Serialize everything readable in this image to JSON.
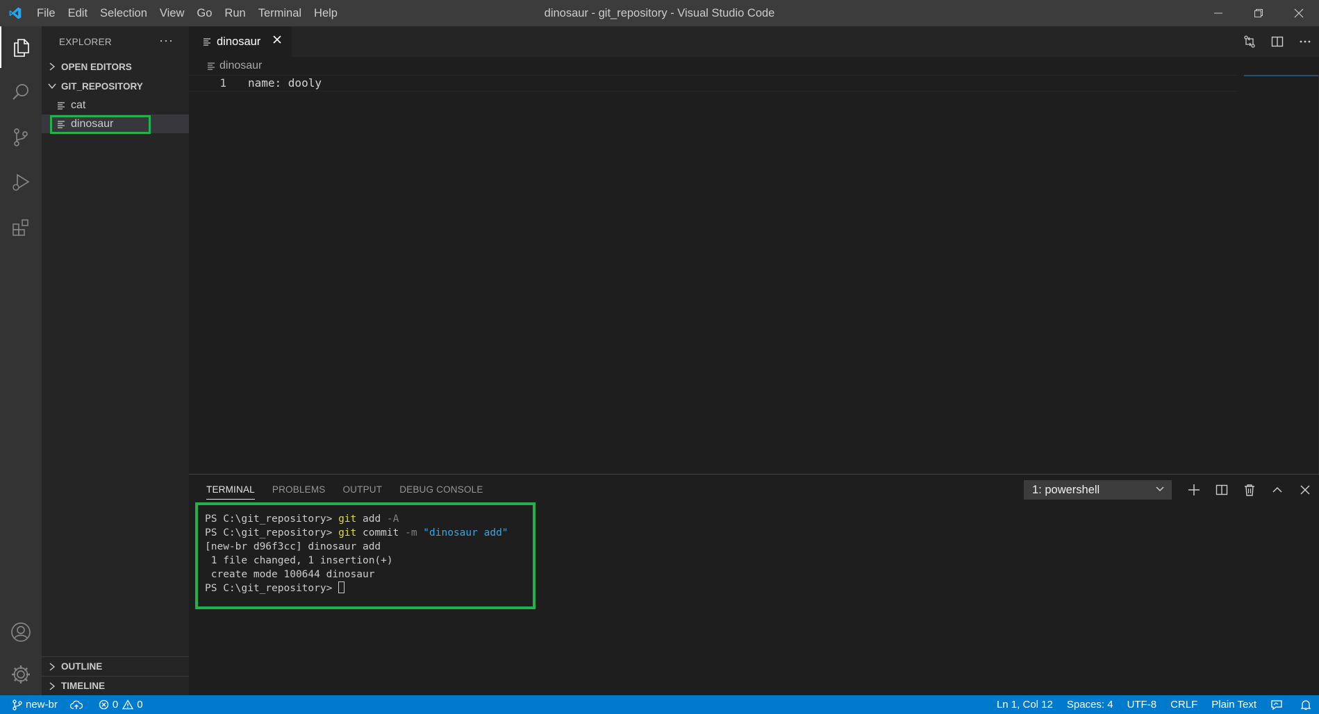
{
  "window": {
    "title": "dinosaur - git_repository - Visual Studio Code",
    "menu": [
      "File",
      "Edit",
      "Selection",
      "View",
      "Go",
      "Run",
      "Terminal",
      "Help"
    ]
  },
  "sidebar": {
    "header": "EXPLORER",
    "more": "···",
    "open_editors": "OPEN EDITORS",
    "folder": "GIT_REPOSITORY",
    "files": [
      "cat",
      "dinosaur"
    ],
    "outline": "OUTLINE",
    "timeline": "TIMELINE"
  },
  "editor": {
    "tab_label": "dinosaur",
    "breadcrumb": "dinosaur",
    "lines": [
      {
        "number": "1",
        "text": "name: dooly"
      }
    ]
  },
  "panel": {
    "tabs": [
      "TERMINAL",
      "PROBLEMS",
      "OUTPUT",
      "DEBUG CONSOLE"
    ],
    "terminal_select": "1: powershell",
    "terminal": {
      "prompt": "PS C:\\git_repository> ",
      "cmd1_git": "git",
      "cmd1_sub": " add ",
      "cmd1_flag": "-A",
      "cmd2_git": "git",
      "cmd2_sub": " commit ",
      "cmd2_flag": "-m",
      "cmd2_msg": " \"dinosaur add\"",
      "out1": "[new-br d96f3cc] dinosaur add",
      "out2": " 1 file changed, 1 insertion(+)",
      "out3": " create mode 100644 dinosaur"
    }
  },
  "statusbar": {
    "branch": "new-br",
    "errors": "0",
    "warnings": "0",
    "position": "Ln 1, Col 12",
    "spaces": "Spaces: 4",
    "encoding": "UTF-8",
    "eol": "CRLF",
    "language": "Plain Text"
  },
  "colors": {
    "highlight": "#22b14c",
    "statusbar": "#007acc",
    "vscode_blue": "#23a9f2"
  }
}
